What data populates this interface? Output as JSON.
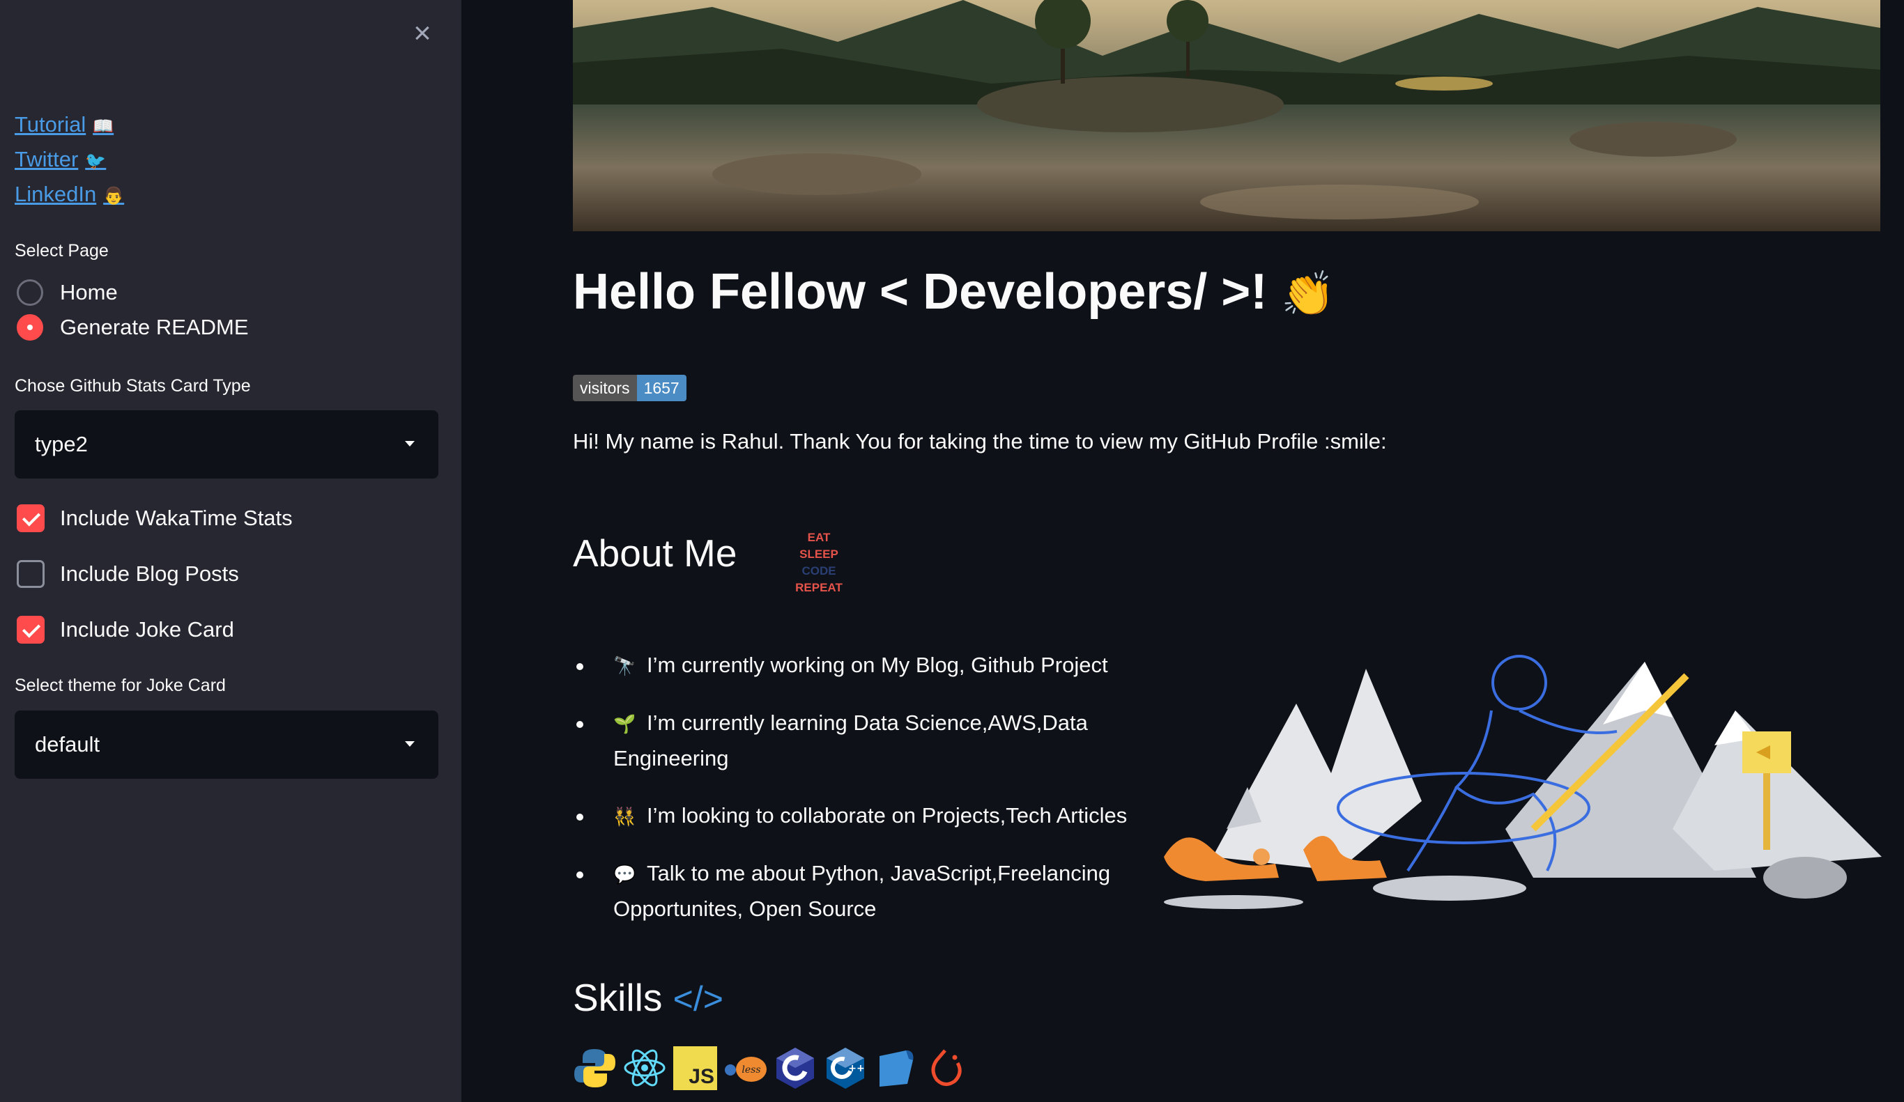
{
  "sidebar": {
    "close_label": "×",
    "links": [
      {
        "label": "Tutorial",
        "emoji": "📖"
      },
      {
        "label": "Twitter",
        "emoji": "🐦"
      },
      {
        "label": "LinkedIn",
        "emoji": "👨"
      }
    ],
    "select_page": {
      "label": "Select Page",
      "options": [
        {
          "label": "Home",
          "selected": false
        },
        {
          "label": "Generate README",
          "selected": true
        }
      ]
    },
    "stats_card": {
      "label": "Chose Github Stats Card Type",
      "value": "type2"
    },
    "checkboxes": [
      {
        "label": "Include WakaTime Stats",
        "checked": true
      },
      {
        "label": "Include Blog Posts",
        "checked": false
      },
      {
        "label": "Include Joke Card",
        "checked": true
      }
    ],
    "joke_theme": {
      "label": "Select theme for Joke Card",
      "value": "default"
    }
  },
  "main": {
    "heading": "Hello Fellow < Developers/ >!",
    "heading_emoji": "👏",
    "badge": {
      "label": "visitors",
      "count": "1657"
    },
    "intro": "Hi! My name is Rahul. Thank You for taking the time to view my GitHub Profile :smile:",
    "about": {
      "title": "About Me",
      "eat_sleep": [
        "EAT",
        "SLEEP",
        "CODE",
        "REPEAT"
      ],
      "items": [
        {
          "emoji": "🔭",
          "text": "I’m currently working on My Blog, Github Project"
        },
        {
          "emoji": "🌱",
          "text": "I’m currently learning Data Science,AWS,Data Engineering"
        },
        {
          "emoji": "👯",
          "text": "I’m looking to collaborate on Projects,Tech Articles"
        },
        {
          "emoji": "💬",
          "text": "Talk to me about Python, JavaScript,Freelancing Opportunites, Open Source"
        }
      ]
    },
    "skills": {
      "title": "Skills",
      "title_icon": "</>",
      "icons": [
        "python-icon",
        "react-icon",
        "javascript-icon",
        "less-icon",
        "c-icon",
        "cplusplus-icon",
        "scikit-learn-icon",
        "pytorch-icon"
      ],
      "js_text": "JS"
    }
  },
  "colors": {
    "accent": "#ff4b4b",
    "link": "#4a9be6",
    "sidebar": "#262730",
    "background": "#0e1117"
  }
}
